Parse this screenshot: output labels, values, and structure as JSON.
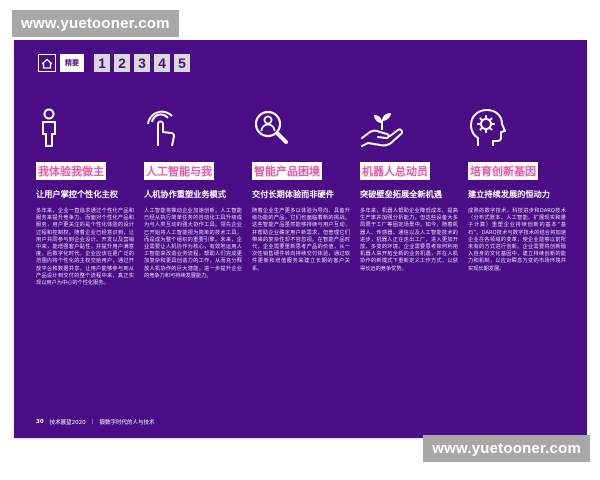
{
  "watermark": {
    "text": "www.yuetooner.com"
  },
  "nav": {
    "label": "精要",
    "numbers": [
      "1",
      "2",
      "3",
      "4",
      "5"
    ]
  },
  "columns": [
    {
      "icon": "person-icon",
      "heading": "我体验我做主",
      "subtitle": "让用户掌控个性化主权",
      "body": "多年来，企业一直追求通过个性化产品和服务来提升竞争力。而面对个性化产品和服务，用户更关注的是个性化体验的设计过程和控制权。随着企业已经意识到，让用户共同参与到企业设计、开发以及营销中来，能增强客户黏性，并提升用户满意度。后数字化时代，企业应该在更广泛的范围内将个性化的主权交给用户，通过开放平台和数据共享，让用户能够参与到从产品设计到交付的整个流程中来，真正实现以用户为中心的个性化服务。"
    },
    {
      "icon": "touch-hand-icon",
      "heading": "人工智能与我",
      "subtitle": "人机协作重塑业务模式",
      "body": "人工智能将推动企业加速创新。人工智能已经从执行简单任务的自动化工具升级成为与人类互动的强大协作工具。领先企业已开始将人工智能视为简单的技术工具，而是成为整个组织的重要引擎。未来，企业需要让人机协作为核心，有效地运用人工智能来改造业务流程，帮助人们完成更加复杂和更具创造力的工作，从而充分释放人机协作的巨大潜能，进一步提升企业的竞争力和可持续发展能力。"
    },
    {
      "icon": "magnifier-person-icon",
      "heading": "智能产品困境",
      "subtitle": "交付长期体验而非硬件",
      "body": "随着企业生产更多以体验为导向、具备升级功能的产品，它们也面临着新的挑战。这些智能产品虽然能够持续与用户互动，并帮助企业确定用户新需求，但管理它们带来的复杂性却不容忽视。在智能产品时代，企业需要重新思考产品的价值，从一次性销售硬件转向持续交付体验，通过软件更新和增值服务来建立长期的客户关系。"
    },
    {
      "icon": "hand-plant-icon",
      "heading": "机器人总动员",
      "subtitle": "突破壁垒拓展全新机遇",
      "body": "多年来，机器人帮助企业降低成本、提高生产率并加强分析能力。但这些设备大多局限于工厂等固定场景中。如今，随着机器人、传感器、通信以及人工智能技术的进步，机器人正在走出工厂，进入更加开放、多变的环境。企业需要思考如何利用机器人来开拓全新的业务机遇，并在人机协作的新模式下重新定义工作方式，以获得长远的竞争优势。"
    },
    {
      "icon": "head-gear-icon",
      "heading": "培育创新基因",
      "subtitle": "建立持续发展的恒动力",
      "body": "成熟的数字技术，科技进步和DARQ技术（分布式账本、人工智能、扩展现实和量子计算）重塑企业持续创新的基本“基石”。DARQ技术与数字技术的结合将加速企业在各领域的变革，使企业能够以前所未有的方式进行创新。企业需要将创新融入自身的文化基因中，建立持续创新的能力和机制，以应对瞬息万变的市场环境并实现长期发展。"
    }
  ],
  "footer": {
    "page_number": "30",
    "report_name": "技术展望2020",
    "subtitle": "锻数字时代的人与技术"
  }
}
